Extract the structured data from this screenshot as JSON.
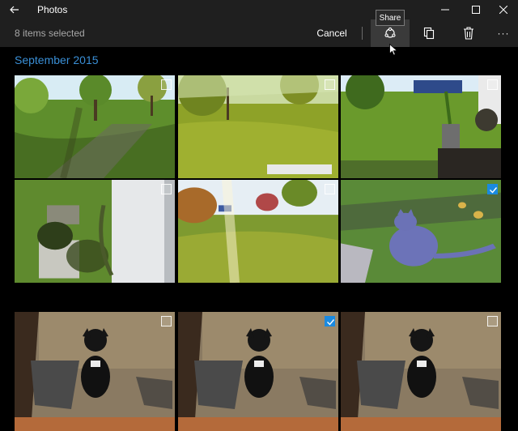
{
  "app": {
    "title": "Photos"
  },
  "window_controls": [
    "minimize-icon",
    "maximize-icon",
    "close-icon"
  ],
  "command_bar": {
    "selected_count": "8 items selected",
    "cancel_label": "Cancel",
    "more_label": "···",
    "buttons": [
      "share-icon",
      "copy-icon",
      "delete-icon",
      "more-icon"
    ]
  },
  "tooltip": {
    "text": "Share"
  },
  "section": {
    "title": "September 2015"
  },
  "colors": {
    "accent": "#1a8ae0",
    "section_title": "#3a8fd6",
    "bar_bg": "#1f1f1f"
  },
  "photos": [
    {
      "subject": "backyard trees shadows",
      "selected": false
    },
    {
      "subject": "yard with fence",
      "selected": false
    },
    {
      "subject": "yard with barn and plants",
      "selected": false
    },
    {
      "subject": "raised garden beds",
      "selected": false
    },
    {
      "subject": "sunlit yard",
      "selected": false
    },
    {
      "subject": "gray cat on grass",
      "selected": true
    },
    {
      "subject": "black dog on rug",
      "selected": false
    },
    {
      "subject": "black dog on rug",
      "selected": true
    },
    {
      "subject": "black dog on rug",
      "selected": false
    }
  ]
}
